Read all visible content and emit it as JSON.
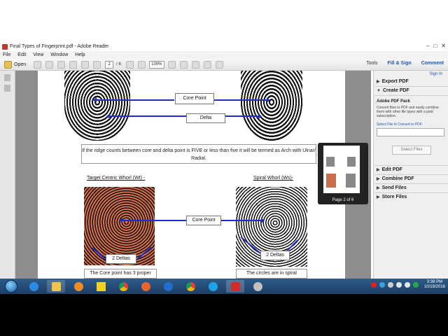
{
  "window": {
    "title": "Final Types of Fingerprint.pdf - Adobe Reader"
  },
  "menu": [
    "File",
    "Edit",
    "View",
    "Window",
    "Help"
  ],
  "toolbar": {
    "open_label": "Open",
    "page_current": "2",
    "page_total": "/ 6",
    "zoom": "100%",
    "tools": "Tools",
    "fill_sign": "Fill & Sign",
    "comment": "Comment"
  },
  "document": {
    "core_point_top": "Core Point",
    "delta_top": "Delta",
    "note": "If the ridge counts between core and delta point is FIVE or less than five it will be termed as Arch with Ulnar/ Radial.",
    "heading_left": "Target Centric Whorl (Wt) -",
    "heading_right": "Spiral Whorl (Ws)-",
    "core_point_mid": "Core Point",
    "deltas_left": "2 Deltas",
    "deltas_right": "2 Deltas",
    "caption_left": "The Core point has 3 proper",
    "caption_right": "The circles are in spiral"
  },
  "thumbnail": {
    "label": "Page 2 of 6"
  },
  "right_panel": {
    "sign_in": "Sign In",
    "export_pdf": "Export PDF",
    "create_pdf": "Create PDF",
    "pdf_pack_title": "Adobe PDF Pack",
    "pdf_pack_desc": "Convert files to PDF and easily combine them with other file types with a paid subscription.",
    "select_file_label": "Select File to Convert to PDF:",
    "select_files_button": "Select Files",
    "edit_pdf": "Edit PDF",
    "combine_pdf": "Combine PDF",
    "send_files": "Send Files",
    "store_files": "Store Files"
  },
  "taskbar": {
    "time": "3:38 PM",
    "date": "10/19/2016"
  },
  "colors": {
    "arrow": "#1e2fc8",
    "link": "#2255aa",
    "taskbar": "#1b3e66"
  }
}
